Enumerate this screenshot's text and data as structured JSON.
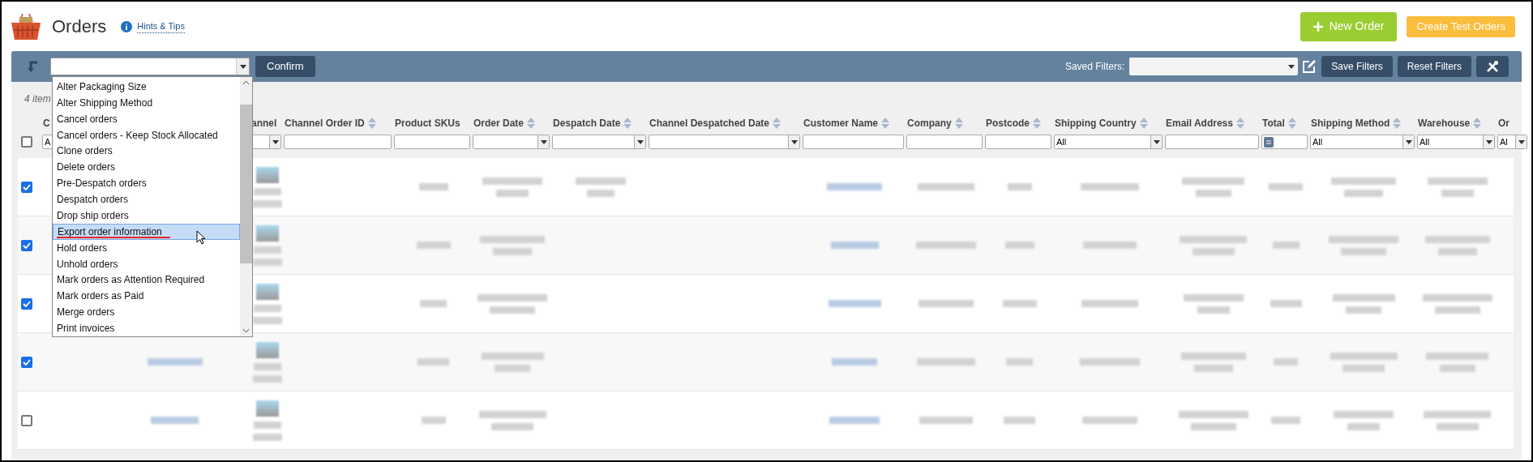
{
  "header": {
    "title": "Orders",
    "hints_link": "Hints & Tips",
    "buttons": [
      {
        "kind": "primary",
        "label": "New Order"
      },
      {
        "kind": "secondary",
        "label": "Create Test Orders"
      }
    ]
  },
  "toolbar": {
    "action_select": {
      "open": true
    },
    "confirm": "Confirm",
    "saved_filters_label": "Saved Filters:",
    "buttons": [
      "Save Filters",
      "Reset Filters"
    ]
  },
  "item_count": "4 item",
  "all_checked": false,
  "columns": [
    {
      "label": "C",
      "filter": {
        "kind": "select",
        "value": "A"
      },
      "kind": "none"
    },
    {
      "filter": {
        "kind": "none"
      },
      "kind": "link"
    },
    {
      "label": "annel",
      "filter": {
        "kind": "select"
      }
    },
    {
      "label": "Channel Order ID",
      "sortable": true,
      "filter": {
        "kind": "text"
      },
      "kind": "none"
    },
    {
      "label": "Product SKUs",
      "sortable": false,
      "filter": {
        "kind": "text"
      },
      "kind": "short"
    },
    {
      "label": "Order Date",
      "sortable": true,
      "filter": {
        "kind": "select"
      },
      "kind": "two-line"
    },
    {
      "label": "Despatch Date",
      "sortable": true,
      "filter": {
        "kind": "select"
      },
      "kind": "first-only"
    },
    {
      "label": "Channel Despatched Date",
      "sortable": true,
      "filter": {
        "kind": "select"
      },
      "kind": "none"
    },
    {
      "label": "Customer Name",
      "sortable": true,
      "filter": {
        "kind": "text"
      },
      "kind": "link"
    },
    {
      "label": "Company",
      "sortable": true,
      "filter": {
        "kind": "text"
      },
      "kind": "line"
    },
    {
      "label": "Postcode",
      "sortable": true,
      "filter": {
        "kind": "text"
      },
      "kind": "short"
    },
    {
      "label": "Shipping Country",
      "sortable": true,
      "filter": {
        "kind": "select",
        "value": "All"
      },
      "kind": "line"
    },
    {
      "label": "Email Address",
      "sortable": true,
      "filter": {
        "kind": "text"
      },
      "kind": "two-line"
    },
    {
      "label": "Total",
      "sortable": true,
      "filter": {
        "kind": "number"
      },
      "kind": "short"
    },
    {
      "label": "Shipping Method",
      "sortable": true,
      "filter": {
        "kind": "select",
        "value": "All"
      },
      "kind": "two-line"
    },
    {
      "label": "Warehouse",
      "sortable": true,
      "filter": {
        "kind": "select",
        "value": "All"
      },
      "kind": "two-line"
    },
    {
      "label": "Or",
      "filter": {
        "kind": "select",
        "value": "Al"
      },
      "kind": "none"
    }
  ],
  "rows": [
    {
      "checked": true
    },
    {
      "checked": true
    },
    {
      "checked": true
    },
    {
      "checked": true
    },
    {
      "checked": false
    }
  ],
  "dropdown_items": [
    {
      "label": "Alter Packaging Size",
      "selected": false,
      "underlined": false
    },
    {
      "label": "Alter Shipping Method",
      "selected": false,
      "underlined": false
    },
    {
      "label": "Cancel orders",
      "selected": false,
      "underlined": false
    },
    {
      "label": "Cancel orders - Keep Stock Allocated",
      "selected": false,
      "underlined": false
    },
    {
      "label": "Clone orders",
      "selected": false,
      "underlined": false
    },
    {
      "label": "Delete orders",
      "selected": false,
      "underlined": false
    },
    {
      "label": "Pre-Despatch orders",
      "selected": false,
      "underlined": false
    },
    {
      "label": "Despatch orders",
      "selected": false,
      "underlined": false
    },
    {
      "label": "Drop ship orders",
      "selected": false,
      "underlined": false
    },
    {
      "label": "Export order information",
      "selected": true,
      "underlined": true
    },
    {
      "label": "Hold orders",
      "selected": false,
      "underlined": false
    },
    {
      "label": "Unhold orders",
      "selected": false,
      "underlined": false
    },
    {
      "label": "Mark orders as Attention Required",
      "selected": false,
      "underlined": false
    },
    {
      "label": "Mark orders as Paid",
      "selected": false,
      "underlined": false
    },
    {
      "label": "Merge orders",
      "selected": false,
      "underlined": false
    },
    {
      "label": "Print invoices",
      "selected": false,
      "underlined": false
    }
  ]
}
